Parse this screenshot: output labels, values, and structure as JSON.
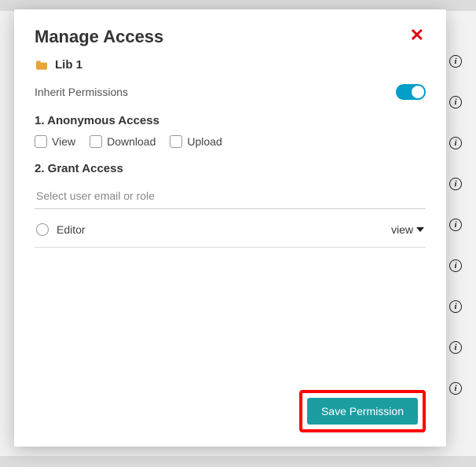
{
  "modal": {
    "title": "Manage Access",
    "folder_name": "Lib 1",
    "inherit_label": "Inherit Permissions",
    "inherit_on": true,
    "section1_heading": "1. Anonymous Access",
    "anon": {
      "view": "View",
      "download": "Download",
      "upload": "Upload"
    },
    "section2_heading": "2. Grant Access",
    "search_placeholder": "Select user email or role",
    "grants": [
      {
        "name": "Editor",
        "permission": "view"
      }
    ],
    "save_label": "Save Permission"
  }
}
